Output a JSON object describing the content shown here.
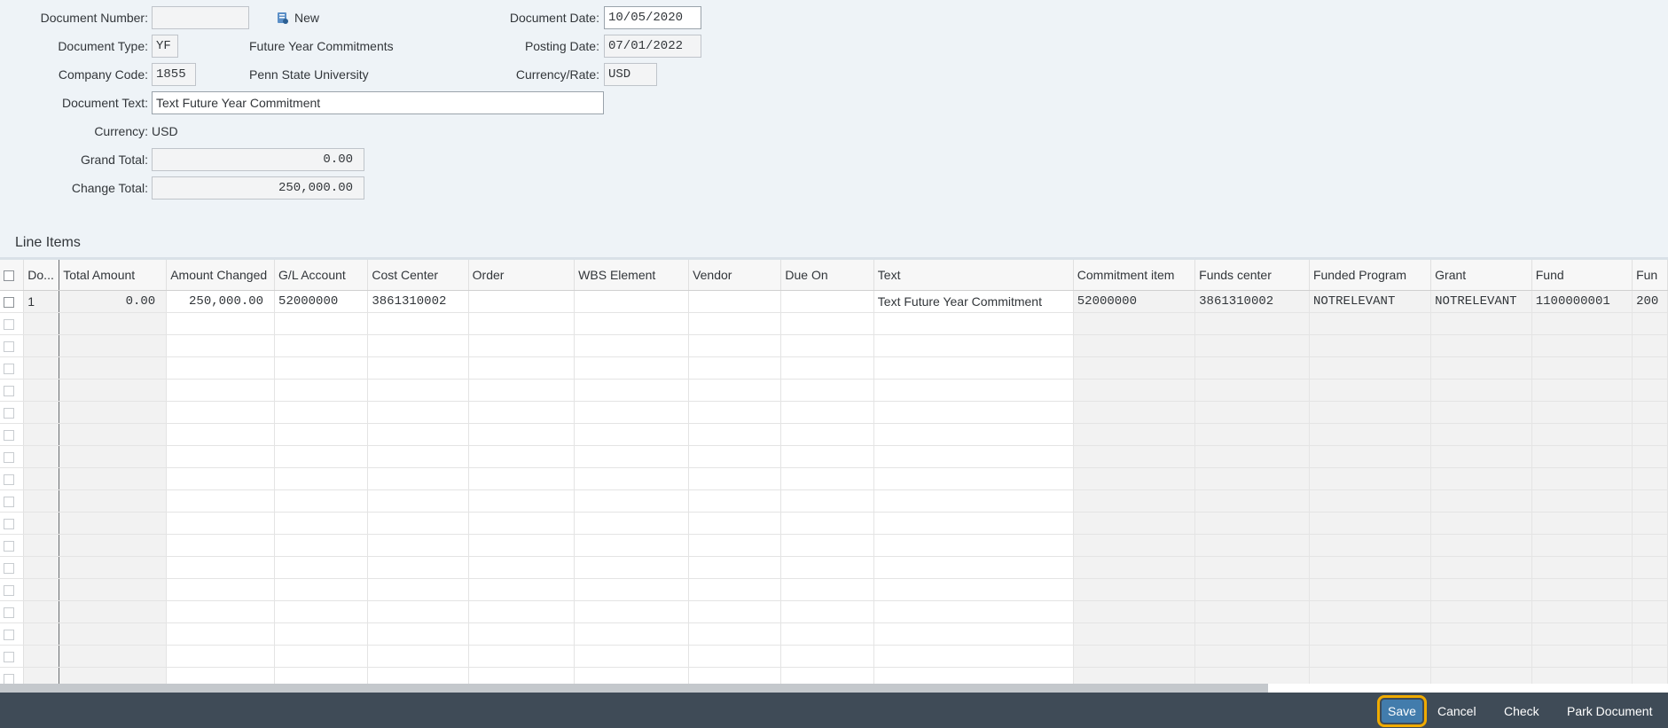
{
  "header": {
    "document_number_label": "Document Number:",
    "document_number_value": "",
    "new_label": "New",
    "document_type_label": "Document Type:",
    "document_type_value": "YF",
    "document_type_desc": "Future Year Commitments",
    "company_code_label": "Company Code:",
    "company_code_value": "1855",
    "company_code_desc": "Penn State University",
    "document_text_label": "Document Text:",
    "document_text_value": "Text Future Year Commitment",
    "currency_label": "Currency:",
    "currency_value": "USD",
    "grand_total_label": "Grand Total:",
    "grand_total_value": "0.00",
    "change_total_label": "Change Total:",
    "change_total_value": "250,000.00",
    "document_date_label": "Document Date:",
    "document_date_value": "10/05/2020",
    "posting_date_label": "Posting Date:",
    "posting_date_value": "07/01/2022",
    "currency_rate_label": "Currency/Rate:",
    "currency_rate_value": "USD"
  },
  "line_items": {
    "title": "Line Items",
    "columns": [
      "Do...",
      "Total Amount",
      "Amount Changed",
      "G/L Account",
      "Cost Center",
      "Order",
      "WBS Element",
      "Vendor",
      "Due On",
      "Text",
      "Commitment item",
      "Funds center",
      "Funded Program",
      "Grant",
      "Fund",
      "Fun"
    ],
    "rows": [
      [
        "1",
        "0.00",
        "250,000.00",
        "52000000",
        "3861310002",
        "",
        "",
        "",
        "",
        "Text Future Year Commitment",
        "52000000",
        "3861310002",
        "NOTRELEVANT",
        "NOTRELEVANT",
        "1100000001",
        "200"
      ]
    ]
  },
  "footer": {
    "save_label": "Save",
    "cancel_label": "Cancel",
    "check_label": "Check",
    "park_label": "Park Document"
  },
  "colors": {
    "background": "#eef3f7",
    "footer": "#3f4b57",
    "primary_button": "#427cac",
    "focus_outline": "#f0ab00"
  }
}
